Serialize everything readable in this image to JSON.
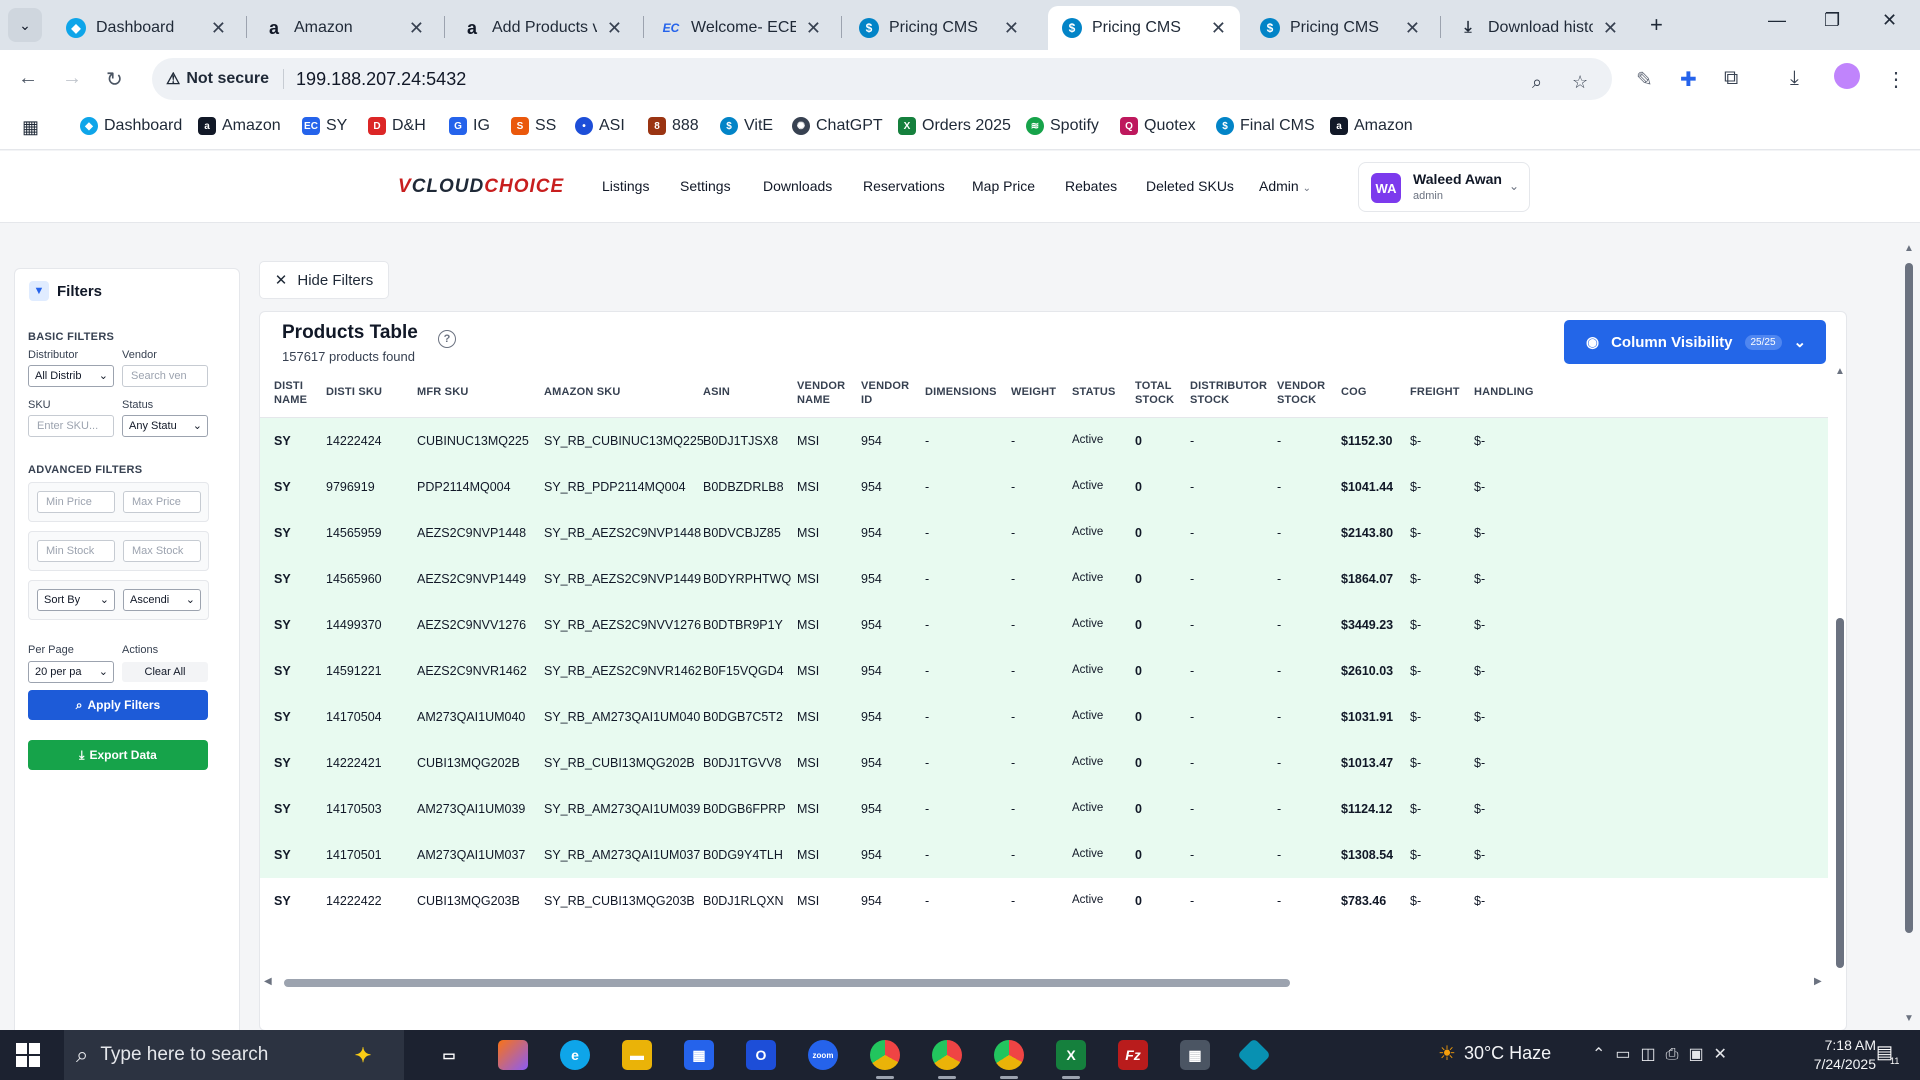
{
  "browser": {
    "tabs": [
      {
        "label": "Dashboard",
        "icon": "dashboard-favicon",
        "active": false
      },
      {
        "label": "Amazon",
        "icon": "amazon-favicon",
        "active": false
      },
      {
        "label": "Add Products via",
        "icon": "amazon-favicon",
        "active": false
      },
      {
        "label": "Welcome- ECExp",
        "icon": "ec-favicon",
        "active": false
      },
      {
        "label": "Pricing CMS",
        "icon": "dollar-favicon",
        "active": false
      },
      {
        "label": "Pricing CMS",
        "icon": "dollar-favicon",
        "active": true
      },
      {
        "label": "Pricing CMS",
        "icon": "dollar-favicon",
        "active": false
      },
      {
        "label": "Download histor",
        "icon": "download-icon",
        "active": false
      }
    ],
    "security_label": "Not secure",
    "url": "199.188.207.24:5432",
    "bookmarks": [
      {
        "label": "Dashboard",
        "icon": "dashboard-favicon",
        "color": "#0ea5e9"
      },
      {
        "label": "Amazon",
        "icon": "amazon-favicon",
        "color": "#111827"
      },
      {
        "label": "SY",
        "icon": "ec-favicon",
        "color": "#2563eb"
      },
      {
        "label": "D&H",
        "icon": "dh-favicon",
        "color": "#dc2626"
      },
      {
        "label": "IG",
        "icon": "ig-favicon",
        "color": "#2563eb"
      },
      {
        "label": "SS",
        "icon": "ss-favicon",
        "color": "#ea580c"
      },
      {
        "label": "ASI",
        "icon": "asi-favicon",
        "color": "#1d4ed8"
      },
      {
        "label": "888",
        "icon": "888-favicon",
        "color": "#9a3412"
      },
      {
        "label": "VitE",
        "icon": "dollar-favicon",
        "color": "#0284c7"
      },
      {
        "label": "ChatGPT",
        "icon": "chatgpt-favicon",
        "color": "#374151"
      },
      {
        "label": "Orders 2025",
        "icon": "excel-favicon",
        "color": "#15803d"
      },
      {
        "label": "Spotify",
        "icon": "spotify-favicon",
        "color": "#16a34a"
      },
      {
        "label": "Quotex",
        "icon": "quotex-favicon",
        "color": "#be185d"
      },
      {
        "label": "Final CMS",
        "icon": "dollar-favicon",
        "color": "#0284c7"
      },
      {
        "label": "Amazon",
        "icon": "amazon-favicon",
        "color": "#111827"
      }
    ]
  },
  "app": {
    "logo_v": "V",
    "logo_cloud": "CLOUD",
    "logo_choice": "CHOICE",
    "nav": [
      "Listings",
      "Settings",
      "Downloads",
      "Reservations",
      "Map Price",
      "Rebates",
      "Deleted SKUs",
      "Admin"
    ],
    "user": {
      "initials": "WA",
      "name": "Waleed Awan",
      "role": "admin"
    }
  },
  "filters": {
    "title": "Filters",
    "basic_title": "BASIC FILTERS",
    "distributor_label": "Distributor",
    "distributor_value": "All Distrib",
    "vendor_label": "Vendor",
    "vendor_placeholder": "Search ven",
    "sku_label": "SKU",
    "sku_placeholder": "Enter SKU...",
    "status_label": "Status",
    "status_value": "Any Statu",
    "advanced_title": "ADVANCED FILTERS",
    "min_price_placeholder": "Min Price",
    "max_price_placeholder": "Max Price",
    "min_stock_placeholder": "Min Stock",
    "max_stock_placeholder": "Max Stock",
    "sort_by_value": "Sort By",
    "order_value": "Ascendi",
    "per_page_label": "Per Page",
    "per_page_value": "20 per pa",
    "actions_label": "Actions",
    "clear_all": "Clear All",
    "apply": "Apply Filters",
    "export": "Export Data"
  },
  "hide_filters": "Hide Filters",
  "table": {
    "title": "Products Table",
    "count": "157617 products found",
    "column_visibility": "Column Visibility",
    "column_badge": "25/25",
    "headers": [
      [
        "DISTI",
        "NAME"
      ],
      [
        "DISTI SKU"
      ],
      [
        "MFR SKU"
      ],
      [
        "AMAZON SKU"
      ],
      [
        "ASIN"
      ],
      [
        "VENDOR",
        "NAME"
      ],
      [
        "VENDOR",
        "ID"
      ],
      [
        "DIMENSIONS"
      ],
      [
        "WEIGHT"
      ],
      [
        "STATUS"
      ],
      [
        "TOTAL",
        "STOCK"
      ],
      [
        "DISTRIBUTOR",
        "STOCK"
      ],
      [
        "VENDOR",
        "STOCK"
      ],
      [
        "COG"
      ],
      [
        "FREIGHT"
      ],
      [
        "HANDLING"
      ]
    ],
    "rows": [
      [
        "SY",
        "14222424",
        "CUBINUC13MQ225",
        "SY_RB_CUBINUC13MQ225",
        "B0DJ1TJSX8",
        "MSI",
        "954",
        "-",
        "-",
        "Active",
        "0",
        "-",
        "-",
        "$1152.30",
        "$-",
        "$-"
      ],
      [
        "SY",
        "9796919",
        "PDP2114MQ004",
        "SY_RB_PDP2114MQ004",
        "B0DBZDRLB8",
        "MSI",
        "954",
        "-",
        "-",
        "Active",
        "0",
        "-",
        "-",
        "$1041.44",
        "$-",
        "$-"
      ],
      [
        "SY",
        "14565959",
        "AEZS2C9NVP1448",
        "SY_RB_AEZS2C9NVP1448",
        "B0DVCBJZ85",
        "MSI",
        "954",
        "-",
        "-",
        "Active",
        "0",
        "-",
        "-",
        "$2143.80",
        "$-",
        "$-"
      ],
      [
        "SY",
        "14565960",
        "AEZS2C9NVP1449",
        "SY_RB_AEZS2C9NVP1449",
        "B0DYRPHTWQ",
        "MSI",
        "954",
        "-",
        "-",
        "Active",
        "0",
        "-",
        "-",
        "$1864.07",
        "$-",
        "$-"
      ],
      [
        "SY",
        "14499370",
        "AEZS2C9NVV1276",
        "SY_RB_AEZS2C9NVV1276",
        "B0DTBR9P1Y",
        "MSI",
        "954",
        "-",
        "-",
        "Active",
        "0",
        "-",
        "-",
        "$3449.23",
        "$-",
        "$-"
      ],
      [
        "SY",
        "14591221",
        "AEZS2C9NVR1462",
        "SY_RB_AEZS2C9NVR1462",
        "B0F15VQGD4",
        "MSI",
        "954",
        "-",
        "-",
        "Active",
        "0",
        "-",
        "-",
        "$2610.03",
        "$-",
        "$-"
      ],
      [
        "SY",
        "14170504",
        "AM273QAI1UM040",
        "SY_RB_AM273QAI1UM040",
        "B0DGB7C5T2",
        "MSI",
        "954",
        "-",
        "-",
        "Active",
        "0",
        "-",
        "-",
        "$1031.91",
        "$-",
        "$-"
      ],
      [
        "SY",
        "14222421",
        "CUBI13MQG202B",
        "SY_RB_CUBI13MQG202B",
        "B0DJ1TGVV8",
        "MSI",
        "954",
        "-",
        "-",
        "Active",
        "0",
        "-",
        "-",
        "$1013.47",
        "$-",
        "$-"
      ],
      [
        "SY",
        "14170503",
        "AM273QAI1UM039",
        "SY_RB_AM273QAI1UM039",
        "B0DGB6FPRP",
        "MSI",
        "954",
        "-",
        "-",
        "Active",
        "0",
        "-",
        "-",
        "$1124.12",
        "$-",
        "$-"
      ],
      [
        "SY",
        "14170501",
        "AM273QAI1UM037",
        "SY_RB_AM273QAI1UM037",
        "B0DG9Y4TLH",
        "MSI",
        "954",
        "-",
        "-",
        "Active",
        "0",
        "-",
        "-",
        "$1308.54",
        "$-",
        "$-"
      ],
      [
        "SY",
        "14222422",
        "CUBI13MQG203B",
        "SY_RB_CUBI13MQG203B",
        "B0DJ1RLQXN",
        "MSI",
        "954",
        "-",
        "-",
        "Active",
        "0",
        "-",
        "-",
        "$783.46",
        "$-",
        "$-"
      ]
    ]
  },
  "taskbar": {
    "search_placeholder": "Type here to search",
    "weather": "30°C  Haze",
    "time": "7:18 AM",
    "date": "7/24/2025",
    "notification_count": "11"
  },
  "colors": {
    "accent_blue": "#2366e8",
    "export_green": "#16a34a",
    "row_bg": "#e8faf0",
    "brand_red": "#c81e1e"
  }
}
